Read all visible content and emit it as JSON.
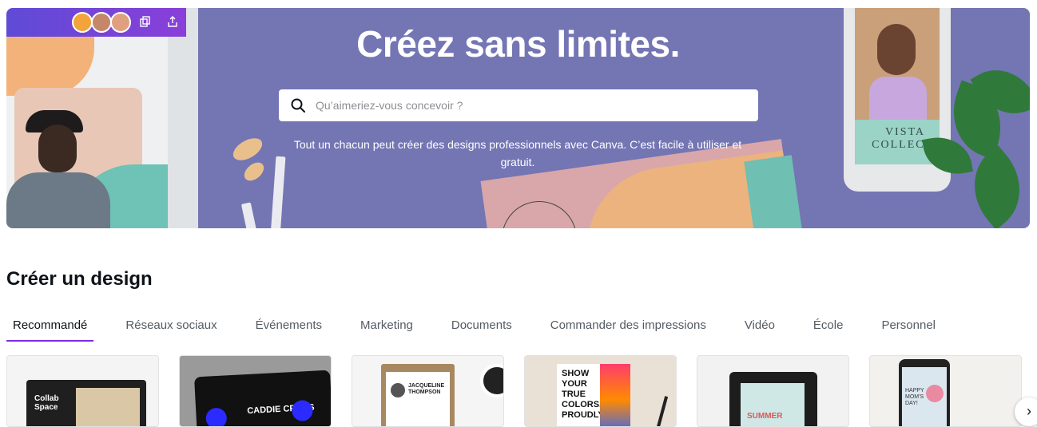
{
  "hero": {
    "title": "Créez sans limites.",
    "search_placeholder": "Qu’aimeriez-vous concevoir ?",
    "subtitle": "Tout un chacun peut créer des designs professionnels avec Canva. C’est facile à utiliser et gratuit.",
    "phone_text": "VISTA\nCOLLECTI",
    "background_color": "#7475b3"
  },
  "section": {
    "title": "Créer un design",
    "tabs": [
      {
        "label": "Recommandé",
        "active": true
      },
      {
        "label": "Réseaux sociaux",
        "active": false
      },
      {
        "label": "Événements",
        "active": false
      },
      {
        "label": "Marketing",
        "active": false
      },
      {
        "label": "Documents",
        "active": false
      },
      {
        "label": "Commander des impressions",
        "active": false
      },
      {
        "label": "Vidéo",
        "active": false
      },
      {
        "label": "École",
        "active": false
      },
      {
        "label": "Personnel",
        "active": false
      }
    ],
    "accent_color": "#7d2ae8"
  },
  "thumbnails": [
    {
      "name": "presentation-thumbnail",
      "text": "Collab Space"
    },
    {
      "name": "video-thumbnail",
      "text": "CADDIE CROSS"
    },
    {
      "name": "resume-thumbnail",
      "text": "JACQUELINE THOMPSON"
    },
    {
      "name": "poster-thumbnail",
      "text": "SHOW YOUR TRUE COLORS. PROUDLY"
    },
    {
      "name": "mobile-thumbnail",
      "text": "SUMMER"
    },
    {
      "name": "card-thumbnail",
      "text": "HAPPY MOM'S DAY!"
    }
  ],
  "scroll_icon": "chevron-right-icon"
}
